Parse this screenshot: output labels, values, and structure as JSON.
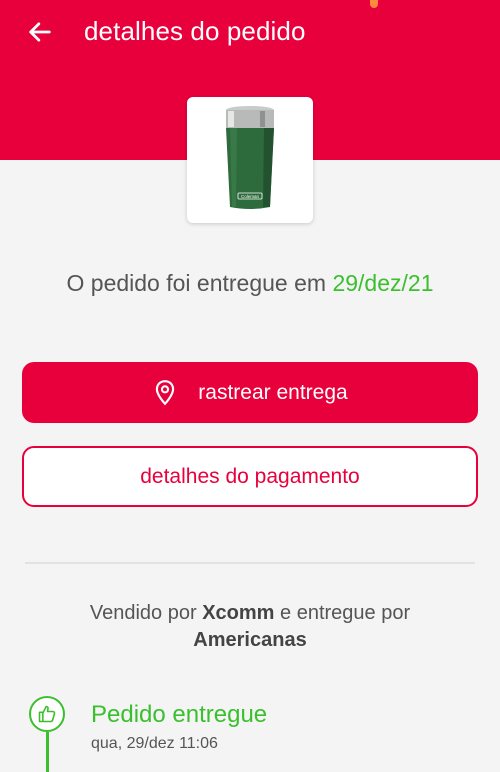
{
  "header": {
    "title": "detalhes do pedido",
    "back_icon": "arrow-left-icon",
    "color": "#e8003c"
  },
  "product": {
    "image_icon": "tumbler-cup-image",
    "brand_label": "Coleman"
  },
  "delivery": {
    "message": "O pedido foi entregue em",
    "date": "29/dez/21",
    "date_color": "#3bbf2f"
  },
  "actions": {
    "track_label": "rastrear entrega",
    "track_icon": "location-pin-icon",
    "payment_label": "detalhes do pagamento"
  },
  "seller": {
    "prefix": "Vendido por",
    "seller_name": "Xcomm",
    "middle": "e entregue por",
    "carrier_name": "Americanas"
  },
  "timeline": {
    "items": [
      {
        "title": "Pedido entregue",
        "date": "qua, 29/dez 11:06",
        "icon": "thumbs-up-icon",
        "color": "#3bbf2f"
      }
    ]
  }
}
